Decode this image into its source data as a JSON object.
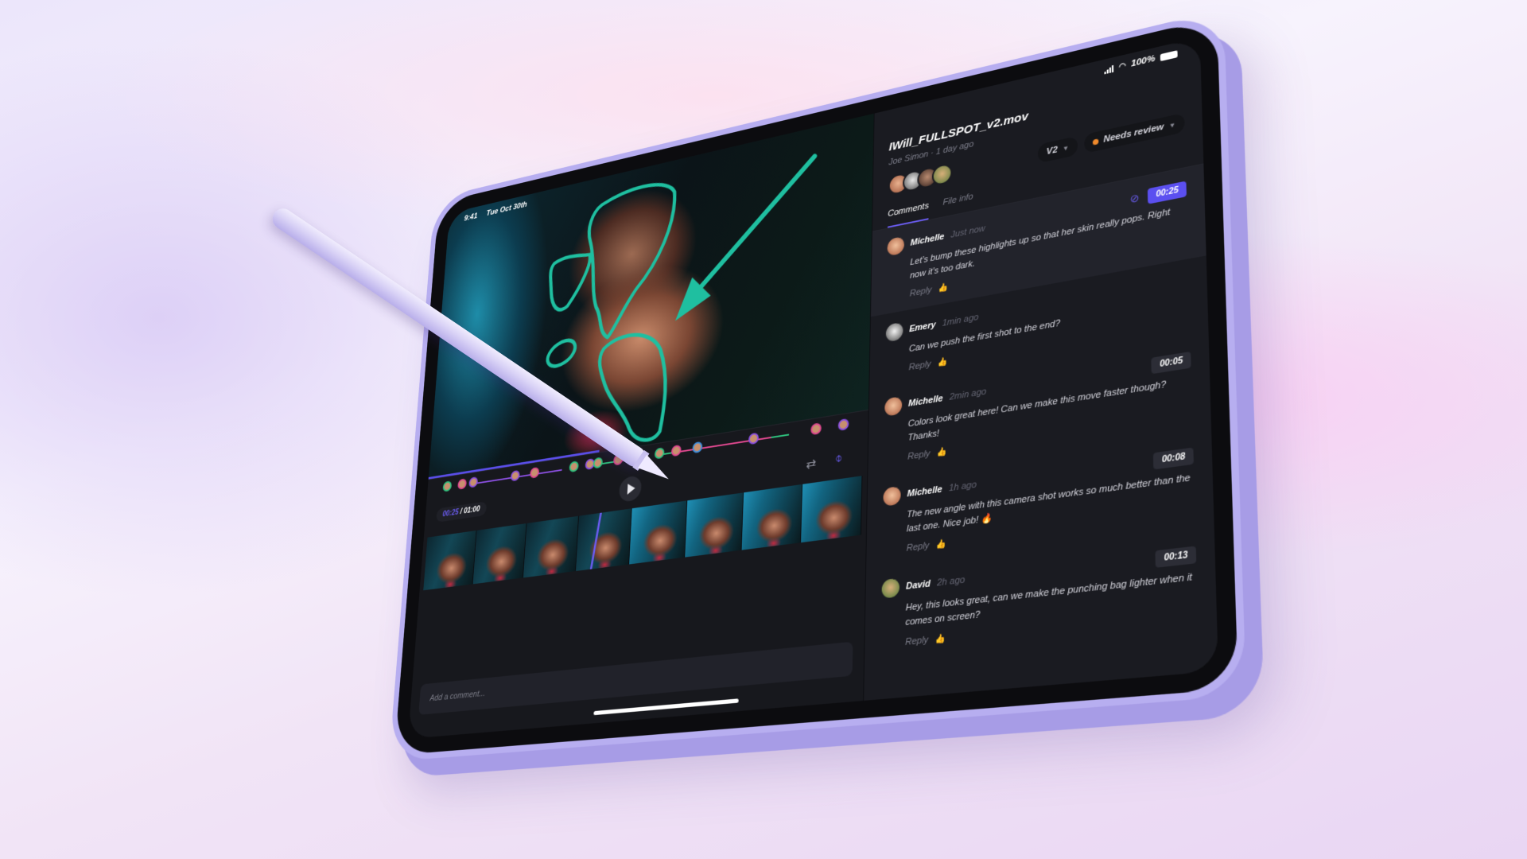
{
  "status_bar": {
    "time": "9:41",
    "date": "Tue Oct 30th",
    "battery": "100%",
    "icons": [
      "signal-icon",
      "wifi-icon",
      "battery-icon"
    ]
  },
  "player": {
    "current_time": "00:25",
    "duration": "/ 01:00",
    "progress_fraction": 0.4167,
    "play_icon": "play-icon",
    "loop_icon": "loop-icon",
    "compare_icon": "compare-icon",
    "annotation_color": "#1fbfa0",
    "accent_color": "#5b4ff0"
  },
  "timeline_markers": [
    {
      "position": 0.02,
      "ring": "#2ec27e"
    },
    {
      "position": 0.06,
      "ring": "#e0488f"
    },
    {
      "position": 0.09,
      "ring": "#8a4fe0"
    },
    {
      "position": 0.2,
      "ring": "#8a4fe0"
    },
    {
      "position": 0.25,
      "ring": "#e0488f"
    },
    {
      "position": 0.35,
      "ring": "#2ec27e"
    },
    {
      "position": 0.39,
      "ring": "#8a4fe0"
    },
    {
      "position": 0.41,
      "ring": "#2ec27e"
    },
    {
      "position": 0.46,
      "ring": "#e0488f"
    },
    {
      "position": 0.56,
      "ring": "#2ec27e"
    },
    {
      "position": 0.6,
      "ring": "#e0488f"
    },
    {
      "position": 0.65,
      "ring": "#3d8fe0"
    },
    {
      "position": 0.78,
      "ring": "#8a4fe0"
    },
    {
      "position": 0.92,
      "ring": "#e0488f"
    },
    {
      "position": 0.98,
      "ring": "#8a4fe0"
    }
  ],
  "comment_input": {
    "placeholder": "Add a comment...",
    "value": ""
  },
  "file": {
    "title": "IWill_FULLSPOT_v2.mov",
    "meta": "Joe Simon · 1 day ago",
    "version": "V2",
    "status": "Needs review",
    "status_color": "#f08a2c",
    "collaborators": [
      "Michelle",
      "Emery",
      "Collaborator",
      "David"
    ]
  },
  "tabs": [
    {
      "label": "Comments",
      "active": true
    },
    {
      "label": "File info",
      "active": false
    }
  ],
  "comments": [
    {
      "author": "Michelle",
      "time": "Just now",
      "timestamp": "00:25",
      "text": "Let’s bump these highlights up so that her skin really pops. Right now it’s too dark.",
      "has_drawing": true,
      "active": true,
      "reply": "Reply"
    },
    {
      "author": "Emery",
      "time": "1min ago",
      "timestamp": "",
      "text": "Can we push the first shot to the end?",
      "has_drawing": false,
      "active": false,
      "reply": "Reply"
    },
    {
      "author": "Michelle",
      "time": "2min ago",
      "timestamp": "00:05",
      "text": "Colors look great here! Can we make this move faster though? Thanks!",
      "has_drawing": false,
      "active": false,
      "reply": "Reply"
    },
    {
      "author": "Michelle",
      "time": "1h ago",
      "timestamp": "00:08",
      "text": "The new angle with this camera shot works so much better than the last one. Nice job! 🔥",
      "has_drawing": false,
      "active": false,
      "reply": "Reply"
    },
    {
      "author": "David",
      "time": "2h ago",
      "timestamp": "00:13",
      "text": "Hey, this looks great, can we make the punching bag lighter when it comes on screen?",
      "has_drawing": false,
      "active": false,
      "reply": "Reply"
    }
  ]
}
